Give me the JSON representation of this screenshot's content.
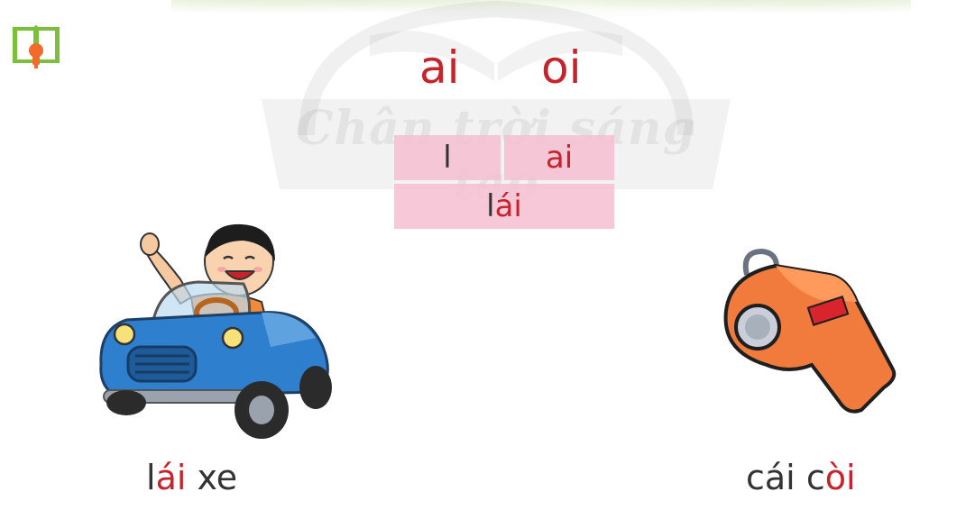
{
  "watermark": {
    "brand": "Chân trời sáng tạo"
  },
  "vowels": {
    "first": "ai",
    "second": "oi"
  },
  "syllable_table": {
    "onset": "l",
    "rime": "ai",
    "word_onset": "l",
    "word_rime": "ái"
  },
  "pictures": {
    "left_caption": {
      "onset": "l",
      "rime": "ái",
      "rest": " xe"
    },
    "right_caption": {
      "pre": "cái c",
      "rime": "òi"
    }
  },
  "icons": {
    "top_left": "open-book-lightbulb-icon",
    "left_picture": "boy-driving-car-picture",
    "right_picture": "whistle-picture"
  },
  "colors": {
    "accent_red": "#c8232c",
    "cell_pink": "#f6bed0",
    "icon_green": "#7cbf3a",
    "icon_orange": "#f26b2a",
    "car_blue": "#2f7fcf",
    "whistle_orange": "#f07b3c"
  }
}
